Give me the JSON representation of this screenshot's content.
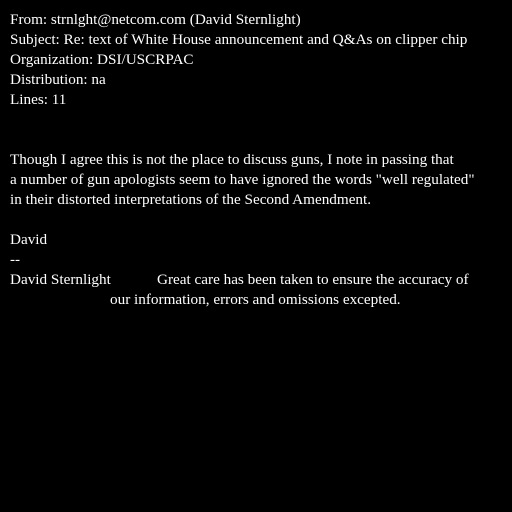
{
  "header": {
    "from": "From: strnlght@netcom.com (David Sternlight)",
    "subject": "Subject: Re: text of White House announcement and Q&As on clipper chip",
    "organization": "Organization: DSI/USCRPAC",
    "distribution": "Distribution: na",
    "lines": "Lines: 11"
  },
  "body": {
    "paragraph_lines": [
      "Though I agree this is not the place to discuss guns, I note in passing that",
      "a number of gun apologists seem to have ignored the words \"well regulated\"",
      "in their distorted interpretations of the Second Amendment."
    ],
    "closing": "David"
  },
  "signature": {
    "separator": "--",
    "name": "David Sternlight",
    "disclaimer_line_1": "Great care has been taken to ensure the accuracy of",
    "disclaimer_line_2": "our information, errors and omissions excepted."
  }
}
